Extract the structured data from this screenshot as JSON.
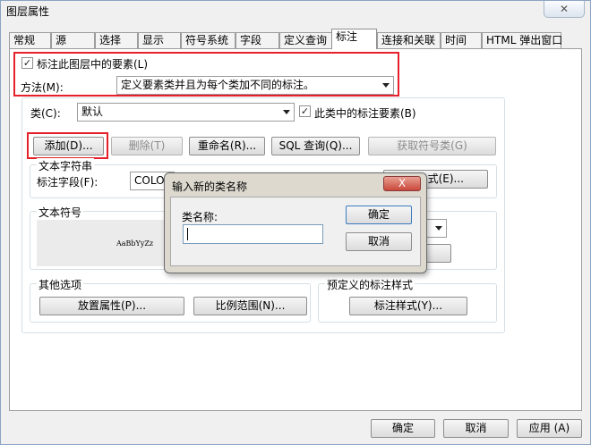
{
  "window": {
    "title": "图层属性",
    "close_label": "✕"
  },
  "tabs": [
    {
      "label": "常规"
    },
    {
      "label": "源"
    },
    {
      "label": "选择"
    },
    {
      "label": "显示"
    },
    {
      "label": "符号系统"
    },
    {
      "label": "字段"
    },
    {
      "label": "定义查询"
    },
    {
      "label": "标注"
    },
    {
      "label": "连接和关联"
    },
    {
      "label": "时间"
    },
    {
      "label": "HTML 弹出窗口"
    }
  ],
  "labeling": {
    "label_features_checkbox": "标注此图层中的要素(L)",
    "method_label": "方法(M):",
    "method_value": "定义要素类并且为每个类加不同的标注。",
    "class_label": "类(C):",
    "class_value": "默认",
    "label_class_features_checkbox": "此类中的标注要素(B)",
    "buttons": {
      "add": "添加(D)...",
      "delete": "删除(T)",
      "rename": "重命名(R)...",
      "sql_query": "SQL 查询(Q)...",
      "get_symbol_classes": "获取符号类(G)"
    },
    "text_string_group": "文本字符串",
    "label_field_label": "标注字段(F):",
    "label_field_value": "COLOR",
    "expression_button": "式(E)...",
    "text_symbol_group": "文本符号",
    "symbol_preview": "AaBbYyZz",
    "other_options_group": "其他选项",
    "placement_properties_button": "放置属性(P)...",
    "scale_range_button": "比例范围(N)...",
    "predefined_styles_group": "预定义的标注样式",
    "label_styles_button": "标注样式(Y)..."
  },
  "footer": {
    "ok": "确定",
    "cancel": "取消",
    "apply": "应用 (A)"
  },
  "dialog": {
    "title": "输入新的类名称",
    "close_label": "X",
    "class_name_label": "类名称:",
    "class_name_value": "",
    "ok": "确定",
    "cancel": "取消"
  },
  "colors": {
    "highlight": "#e5202a"
  }
}
